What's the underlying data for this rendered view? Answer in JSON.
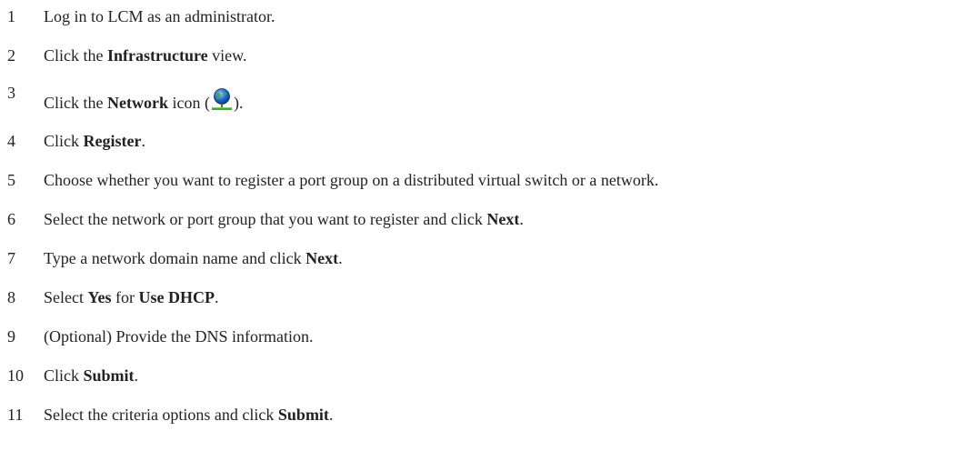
{
  "steps": [
    {
      "n": "1",
      "parts": [
        {
          "t": "Log in to LCM as an administrator."
        }
      ]
    },
    {
      "n": "2",
      "parts": [
        {
          "t": "Click the "
        },
        {
          "t": "Infrastructure",
          "b": true
        },
        {
          "t": " view."
        }
      ]
    },
    {
      "n": "3",
      "parts": [
        {
          "t": "Click the "
        },
        {
          "t": "Network",
          "b": true
        },
        {
          "t": " icon ("
        },
        {
          "icon": "network-icon"
        },
        {
          "t": ")."
        }
      ]
    },
    {
      "n": "4",
      "parts": [
        {
          "t": "Click "
        },
        {
          "t": "Register",
          "b": true
        },
        {
          "t": "."
        }
      ]
    },
    {
      "n": "5",
      "parts": [
        {
          "t": "Choose whether you want to register a port group on a distributed virtual switch or a network."
        }
      ]
    },
    {
      "n": "6",
      "parts": [
        {
          "t": "Select the network or port group that you want to register and click "
        },
        {
          "t": "Next",
          "b": true
        },
        {
          "t": "."
        }
      ]
    },
    {
      "n": "7",
      "parts": [
        {
          "t": "Type a network domain name and click "
        },
        {
          "t": "Next",
          "b": true
        },
        {
          "t": "."
        }
      ]
    },
    {
      "n": "8",
      "parts": [
        {
          "t": "Select "
        },
        {
          "t": "Yes",
          "b": true
        },
        {
          "t": " for "
        },
        {
          "t": "Use DHCP",
          "b": true
        },
        {
          "t": "."
        }
      ]
    },
    {
      "n": "9",
      "parts": [
        {
          "t": "(Optional) Provide the DNS information."
        }
      ]
    },
    {
      "n": "10",
      "parts": [
        {
          "t": "Click "
        },
        {
          "t": "Submit",
          "b": true
        },
        {
          "t": "."
        }
      ]
    },
    {
      "n": "11",
      "parts": [
        {
          "t": "Select the criteria options and click "
        },
        {
          "t": "Submit",
          "b": true
        },
        {
          "t": "."
        }
      ]
    }
  ]
}
